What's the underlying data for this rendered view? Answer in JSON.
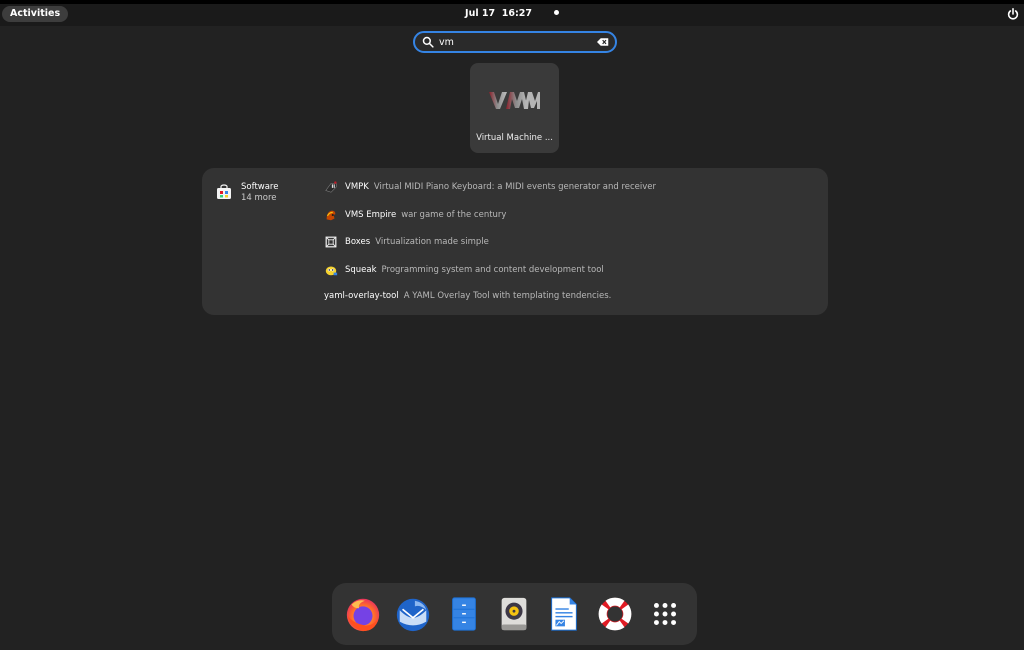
{
  "topbar": {
    "activities_label": "Activities",
    "clock": "Jul 17  16:27"
  },
  "search": {
    "value": "vm",
    "placeholder": ""
  },
  "app_results": [
    {
      "label": "Virtual Machine ...",
      "logo_text": "VMM"
    }
  ],
  "software": {
    "provider_name": "Software",
    "provider_more": "14 more",
    "results": [
      {
        "name": "VMPK",
        "description": "Virtual MIDI Piano Keyboard: a MIDI events generator and receiver",
        "icon": "piano-icon"
      },
      {
        "name": "VMS Empire",
        "description": "war game of the century",
        "icon": "empire-icon"
      },
      {
        "name": "Boxes",
        "description": "Virtualization made simple",
        "icon": "boxes-icon"
      },
      {
        "name": "Squeak",
        "description": "Programming system and content development tool",
        "icon": "squeak-icon"
      },
      {
        "name": "yaml-overlay-tool",
        "description": "A YAML Overlay Tool with templating tendencies.",
        "icon": ""
      }
    ]
  },
  "dash": {
    "items": [
      "firefox-icon",
      "thunderbird-icon",
      "files-icon",
      "rhythmbox-icon",
      "libreoffice-writer-icon",
      "help-icon",
      "show-apps-icon"
    ]
  },
  "colors": {
    "accent": "#3584e4",
    "background": "#222222",
    "panel": "#333333"
  }
}
